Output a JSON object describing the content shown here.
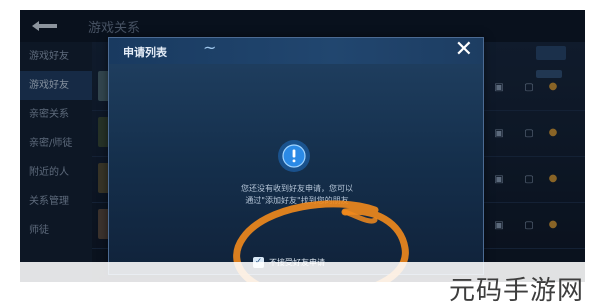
{
  "topbar": {
    "title": "游戏关系"
  },
  "sidebar": {
    "items": [
      {
        "label": "游戏好友",
        "active": false
      },
      {
        "label": "游戏好友",
        "active": true
      },
      {
        "label": "亲密关系",
        "active": false
      },
      {
        "label": "亲密/师徒",
        "active": false
      },
      {
        "label": "附近的人",
        "active": false
      },
      {
        "label": "关系管理",
        "active": false
      },
      {
        "label": "师徒",
        "active": false
      }
    ]
  },
  "modal": {
    "title": "申请列表",
    "empty_text_line1": "您还没有收到好友申请，您可以",
    "empty_text_line2": "通过\"添加好友\"找到您的朋友",
    "checkbox_label": "不接受好友申请",
    "checkbox_checked": true
  },
  "watermark": {
    "text": "元码手游网"
  },
  "colors": {
    "accent": "#f28a1c",
    "panel": "#17304d"
  }
}
